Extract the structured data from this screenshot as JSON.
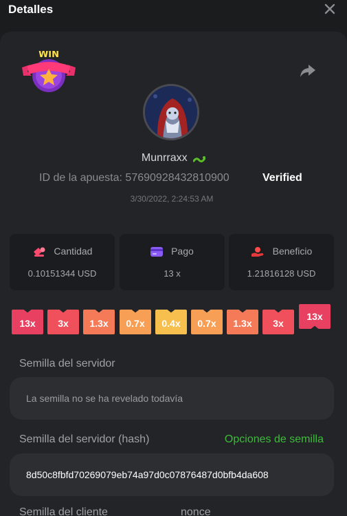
{
  "header": {
    "title": "Detalles",
    "close_icon": "close-icon"
  },
  "bet": {
    "username": "Munrraxx",
    "bet_id_label": "ID de la apuesta:",
    "bet_id": "5769092843281090",
    "bet_id_suffix": "0",
    "verified": "Verified",
    "date": "3/30/2022, 2:24:53 AM"
  },
  "stats": [
    {
      "label": "Cantidad",
      "value": "0.10151344 USD",
      "icon": "coins-icon"
    },
    {
      "label": "Pago",
      "value": "13 x",
      "icon": "card-icon"
    },
    {
      "label": "Beneficio",
      "value": "1.21816128 USD",
      "icon": "hand-coin-icon"
    }
  ],
  "multipliers": [
    {
      "label": "13x",
      "color": "#e84060",
      "raised": false
    },
    {
      "label": "3x",
      "color": "#f0505c",
      "raised": false
    },
    {
      "label": "1.3x",
      "color": "#f57a58",
      "raised": false
    },
    {
      "label": "0.7x",
      "color": "#f7a055",
      "raised": false
    },
    {
      "label": "0.4x",
      "color": "#f7bf4e",
      "raised": false
    },
    {
      "label": "0.7x",
      "color": "#f7a055",
      "raised": false
    },
    {
      "label": "1.3x",
      "color": "#f57a58",
      "raised": false
    },
    {
      "label": "3x",
      "color": "#f0505c",
      "raised": false
    },
    {
      "label": "13x",
      "color": "#e84060",
      "raised": true
    }
  ],
  "server_seed": {
    "label": "Semilla del servidor",
    "value": "La semilla no se ha revelado todavía"
  },
  "server_seed_hash": {
    "label": "Semilla del servidor (hash)",
    "link": "Opciones de semilla",
    "value": "8d50c8fbfd70269079eb74a97d0c07876487d0bfb4da608"
  },
  "client_seed": {
    "label": "Semilla del cliente",
    "nonce_label": "nonce"
  },
  "colors": {
    "accent_green": "#3dbb3a",
    "background": "#1b1c1e",
    "panel": "#232427"
  }
}
